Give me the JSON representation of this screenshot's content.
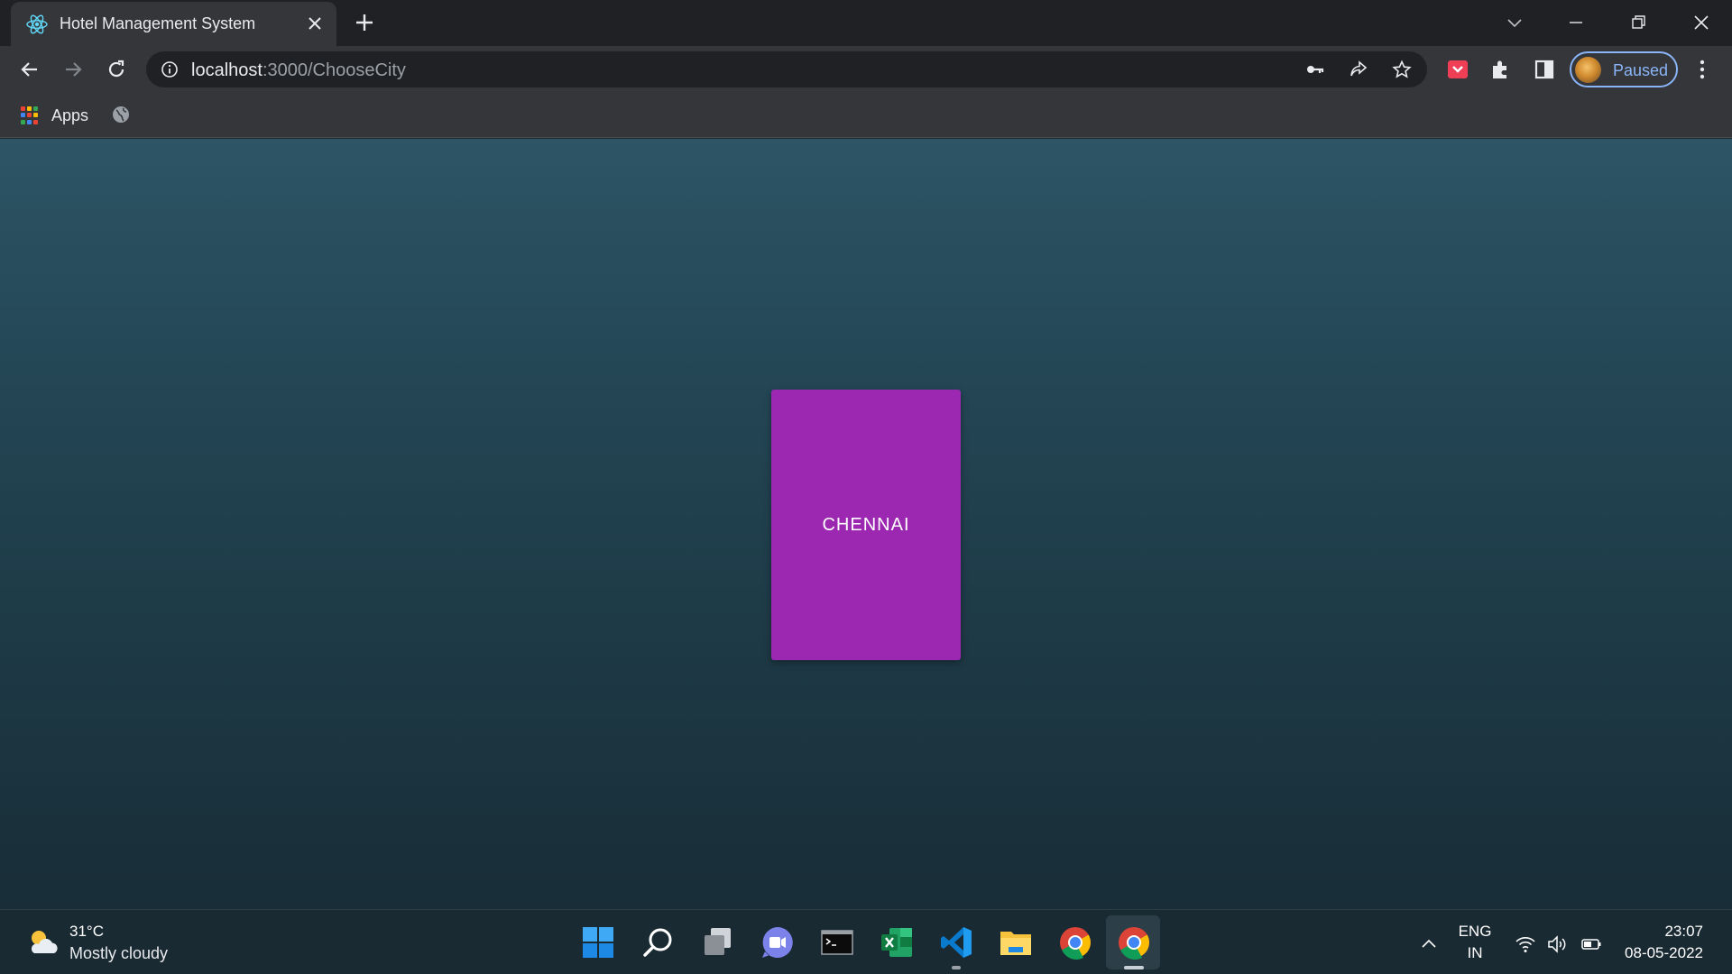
{
  "browser": {
    "tab": {
      "title": "Hotel Management System"
    },
    "address": {
      "host": "localhost",
      "path": ":3000/ChooseCity"
    },
    "profile": {
      "status": "Paused"
    },
    "bookmarks": {
      "apps_label": "Apps"
    }
  },
  "page": {
    "cities": [
      {
        "name": "CHENNAI"
      }
    ],
    "card_color": "#9c27b0"
  },
  "taskbar": {
    "weather": {
      "temp": "31°C",
      "desc": "Mostly cloudy"
    },
    "lang": {
      "line1": "ENG",
      "line2": "IN"
    },
    "clock": {
      "time": "23:07",
      "date": "08-05-2022"
    },
    "apps": [
      "start-icon",
      "search-icon",
      "task-view-icon",
      "teams-chat-icon",
      "terminal-icon",
      "excel-icon",
      "vscode-icon",
      "file-explorer-icon",
      "chrome-icon",
      "chrome-active-icon"
    ]
  }
}
